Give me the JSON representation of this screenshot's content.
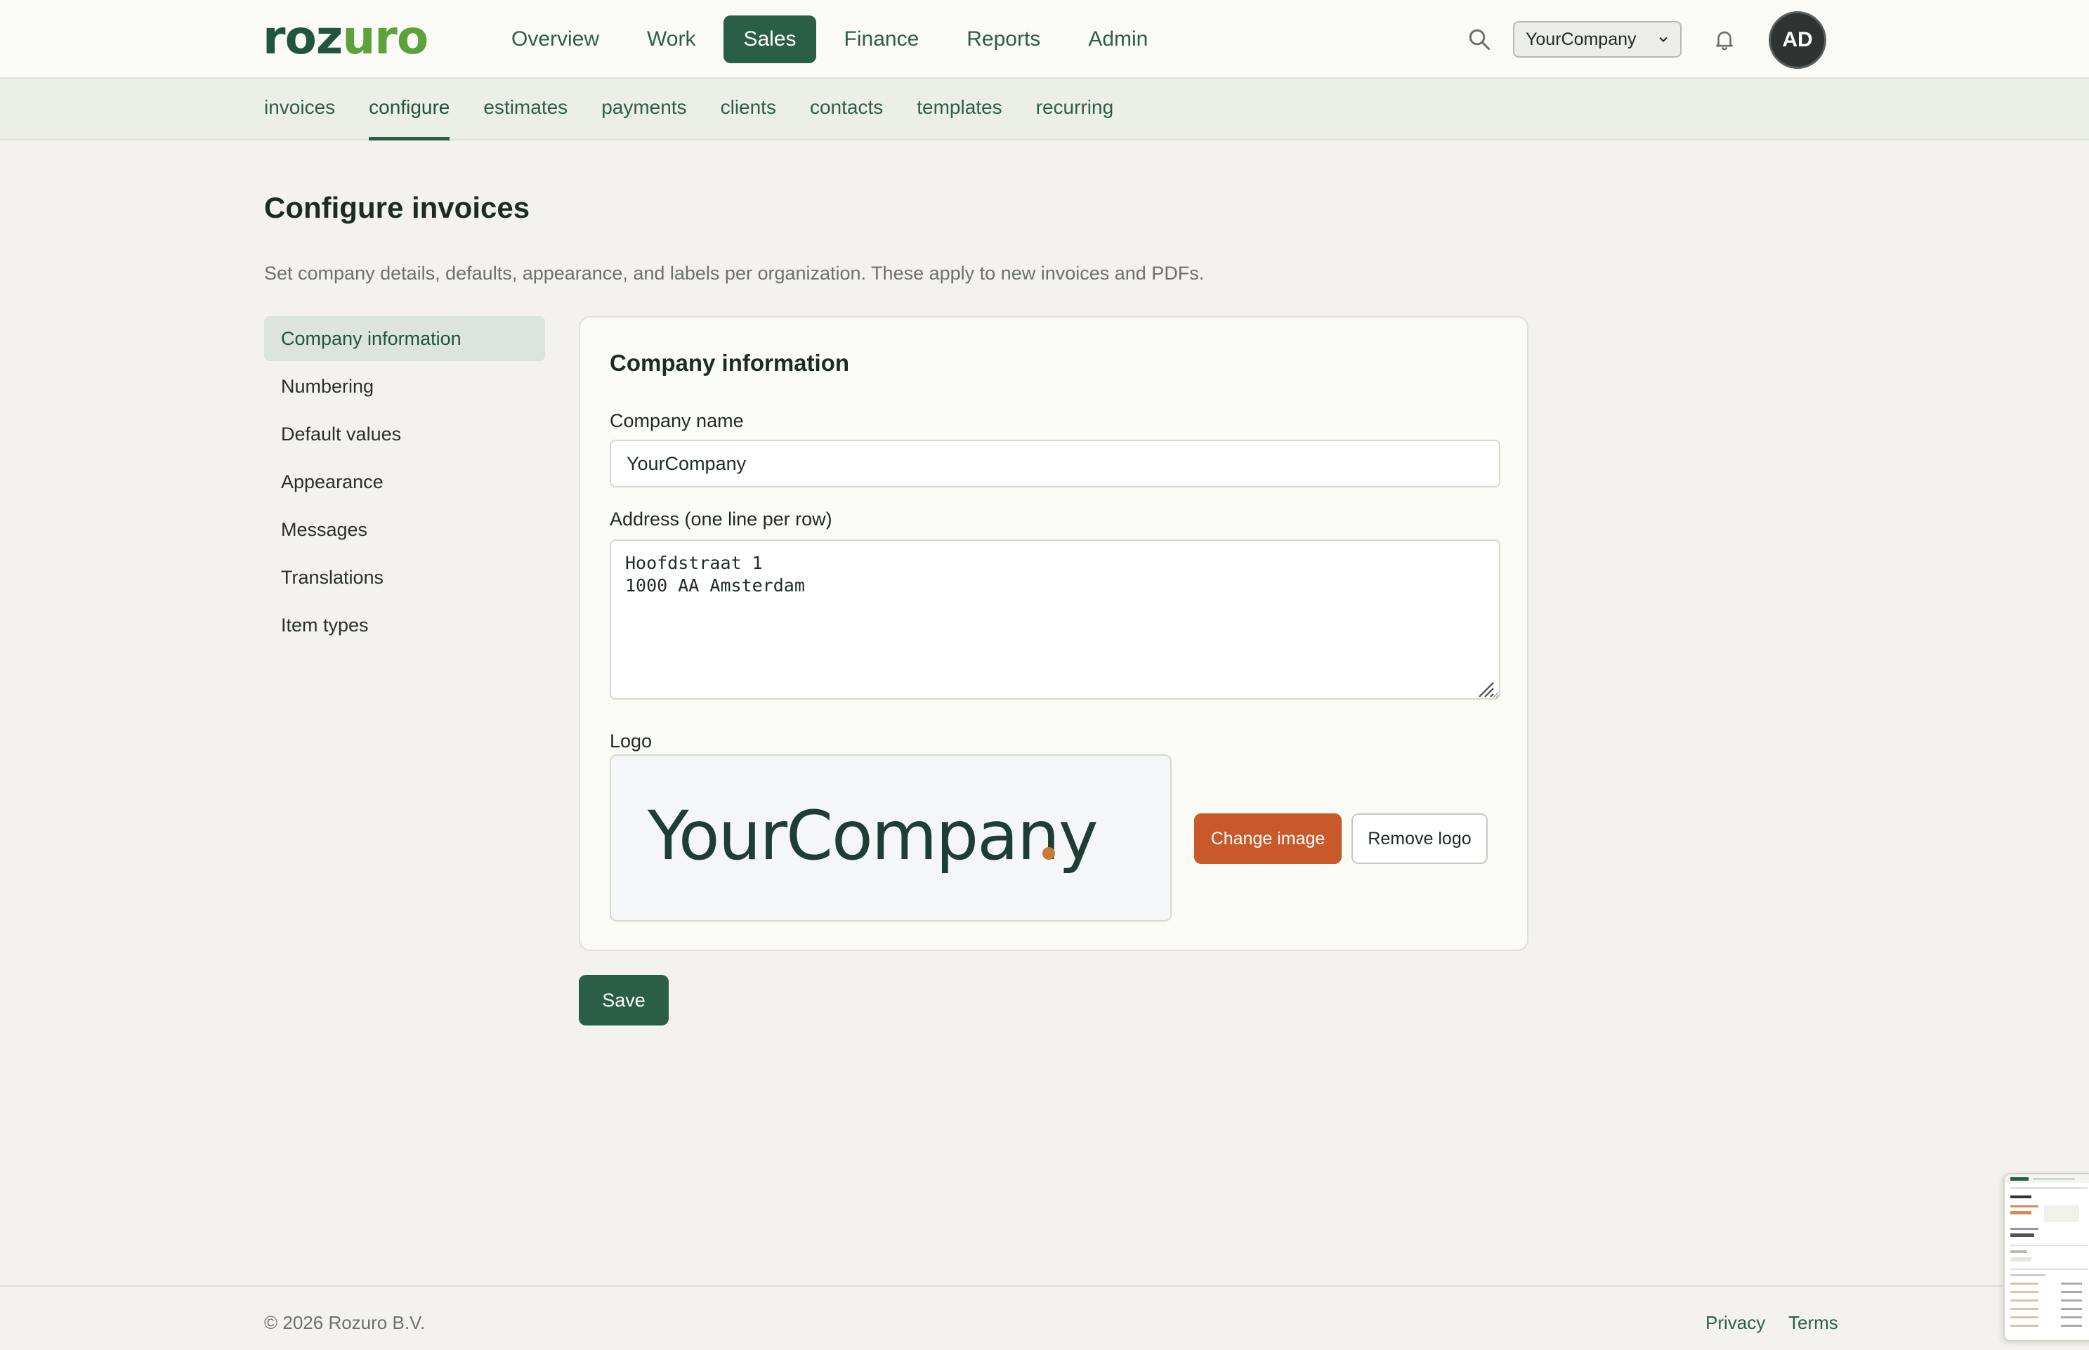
{
  "brand": {
    "logo_dark": "roz",
    "logo_light": "uro"
  },
  "topnav": {
    "items": [
      {
        "label": "Overview",
        "active": false
      },
      {
        "label": "Work",
        "active": false
      },
      {
        "label": "Sales",
        "active": true
      },
      {
        "label": "Finance",
        "active": false
      },
      {
        "label": "Reports",
        "active": false
      },
      {
        "label": "Admin",
        "active": false
      }
    ],
    "company_selected": "YourCompany",
    "avatar_initials": "AD"
  },
  "subnav": {
    "items": [
      {
        "label": "invoices",
        "active": false
      },
      {
        "label": "configure",
        "active": true
      },
      {
        "label": "estimates",
        "active": false
      },
      {
        "label": "payments",
        "active": false
      },
      {
        "label": "clients",
        "active": false
      },
      {
        "label": "contacts",
        "active": false
      },
      {
        "label": "templates",
        "active": false
      },
      {
        "label": "recurring",
        "active": false
      }
    ]
  },
  "page": {
    "title": "Configure invoices",
    "description": "Set company details, defaults, appearance, and labels per organization. These apply to new invoices and PDFs."
  },
  "sidenav": {
    "items": [
      {
        "label": "Company information",
        "active": true
      },
      {
        "label": "Numbering",
        "active": false
      },
      {
        "label": "Default values",
        "active": false
      },
      {
        "label": "Appearance",
        "active": false
      },
      {
        "label": "Messages",
        "active": false
      },
      {
        "label": "Translations",
        "active": false
      },
      {
        "label": "Item types",
        "active": false
      }
    ]
  },
  "form": {
    "card_title": "Company information",
    "company_name_label": "Company name",
    "company_name_value": "YourCompany",
    "address_label": "Address (one line per row)",
    "address_value": "Hoofdstraat 1\n1000 AA Amsterdam",
    "logo_label": "Logo",
    "logo_preview_text": "YourCompany",
    "change_image_label": "Change image",
    "remove_logo_label": "Remove logo",
    "save_label": "Save"
  },
  "footer": {
    "copyright": "© 2026 Rozuro B.V.",
    "privacy_label": "Privacy",
    "terms_label": "Terms"
  },
  "colors": {
    "brand_green": "#2a5e46",
    "accent_orange": "#c9582a",
    "logo_dot": "#c9793a"
  }
}
